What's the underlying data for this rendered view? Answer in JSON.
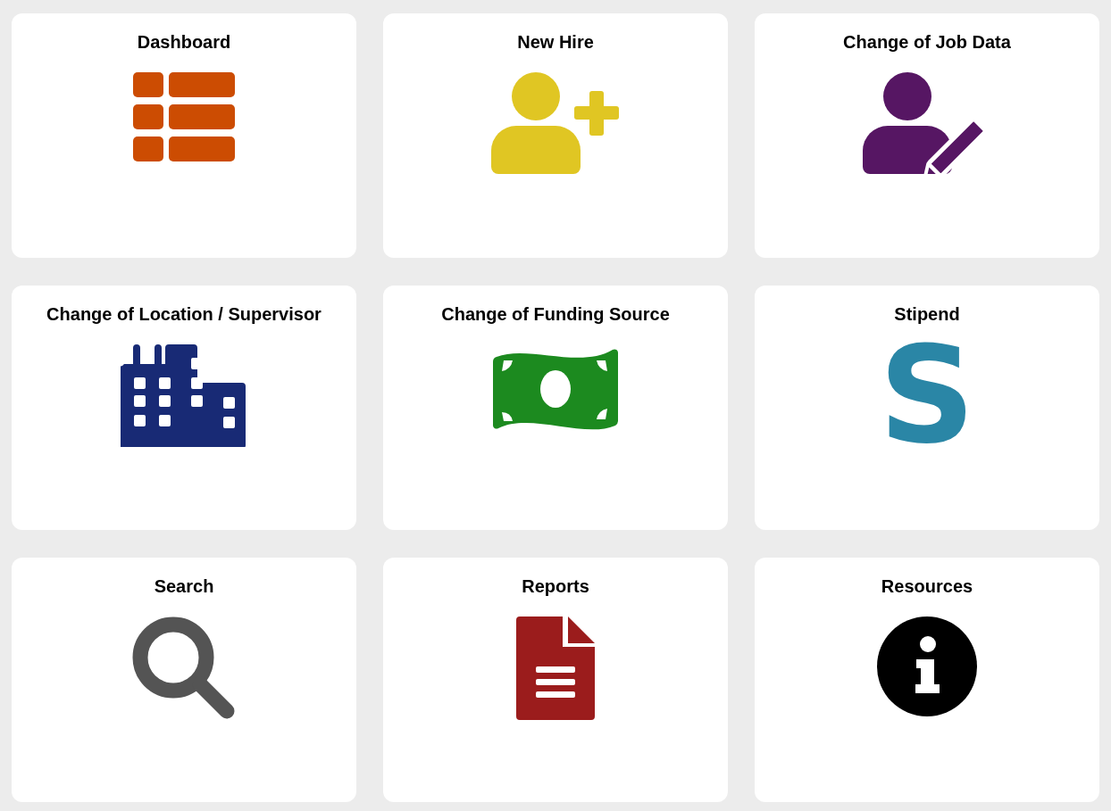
{
  "tiles": [
    {
      "title": "Dashboard",
      "kind": "grid",
      "color": "#cc4c02"
    },
    {
      "title": "New Hire",
      "kind": "user-plus",
      "color": "#e0c623"
    },
    {
      "title": "Change of Job Data",
      "kind": "user-edit",
      "color": "#561663"
    },
    {
      "title": "Change of Location / Supervisor",
      "kind": "building",
      "color": "#182a75"
    },
    {
      "title": "Change of Funding Source",
      "kind": "money",
      "color": "#1c8a1f"
    },
    {
      "title": "Stipend",
      "kind": "letter",
      "glyph": "S",
      "color": "#2a86a6"
    },
    {
      "title": "Search",
      "kind": "search",
      "color": "#545454"
    },
    {
      "title": "Reports",
      "kind": "document",
      "color": "#9b1c1c"
    },
    {
      "title": "Resources",
      "kind": "info",
      "color": "#000000"
    }
  ]
}
